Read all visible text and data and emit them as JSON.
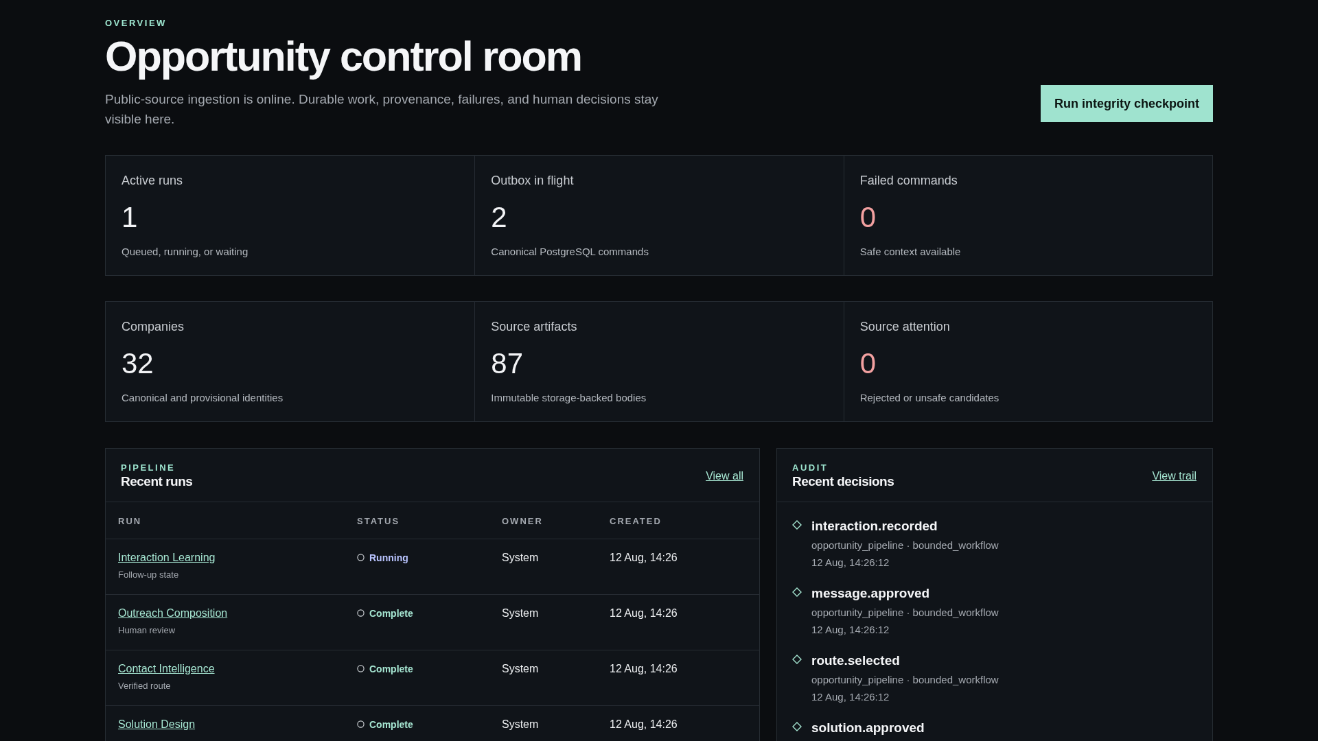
{
  "header": {
    "eyebrow": "OVERVIEW",
    "title": "Opportunity control room",
    "subtitle": "Public-source ingestion is online. Durable work, provenance, failures, and human decisions stay visible here.",
    "action": "Run integrity checkpoint"
  },
  "stat_rows": [
    [
      {
        "label": "Active runs",
        "value": "1",
        "color": "#f3f4f6",
        "caption": "Queued, running, or waiting"
      },
      {
        "label": "Outbox in flight",
        "value": "2",
        "color": "#f3f4f6",
        "caption": "Canonical PostgreSQL commands"
      },
      {
        "label": "Failed commands",
        "value": "0",
        "color": "#f2a0a0",
        "caption": "Safe context available"
      }
    ],
    [
      {
        "label": "Companies",
        "value": "32",
        "color": "#f3f4f6",
        "caption": "Canonical and provisional identities"
      },
      {
        "label": "Source artifacts",
        "value": "87",
        "color": "#f3f4f6",
        "caption": "Immutable storage-backed bodies"
      },
      {
        "label": "Source attention",
        "value": "0",
        "color": "#f2a0a0",
        "caption": "Rejected or unsafe candidates"
      }
    ]
  ],
  "runs_panel": {
    "eyebrow": "PIPELINE",
    "title": "Recent runs",
    "link": "View all",
    "columns": [
      "RUN",
      "STATUS",
      "OWNER",
      "CREATED"
    ],
    "rows": [
      {
        "name": "Interaction Learning",
        "detail": "Follow-up state",
        "status": "Running",
        "color": "#b9c4ff",
        "owner": "System",
        "created": "12 Aug, 14:26"
      },
      {
        "name": "Outreach Composition",
        "detail": "Human review",
        "status": "Complete",
        "color": "#a6e6d2",
        "owner": "System",
        "created": "12 Aug, 14:26"
      },
      {
        "name": "Contact Intelligence",
        "detail": "Verified route",
        "status": "Complete",
        "color": "#a6e6d2",
        "owner": "System",
        "created": "12 Aug, 14:26"
      },
      {
        "name": "Solution Design",
        "status": "Complete",
        "color": "#a6e6d2",
        "owner": "System",
        "created": "12 Aug, 14:26"
      }
    ]
  },
  "decisions_panel": {
    "eyebrow": "AUDIT",
    "title": "Recent decisions",
    "link": "View trail",
    "items": [
      {
        "event": "interaction.recorded",
        "context": "opportunity_pipeline · bounded_workflow",
        "time": "12 Aug, 14:26:12"
      },
      {
        "event": "message.approved",
        "context": "opportunity_pipeline · bounded_workflow",
        "time": "12 Aug, 14:26:12"
      },
      {
        "event": "route.selected",
        "context": "opportunity_pipeline · bounded_workflow",
        "time": "12 Aug, 14:26:12"
      },
      {
        "event": "solution.approved"
      }
    ]
  }
}
